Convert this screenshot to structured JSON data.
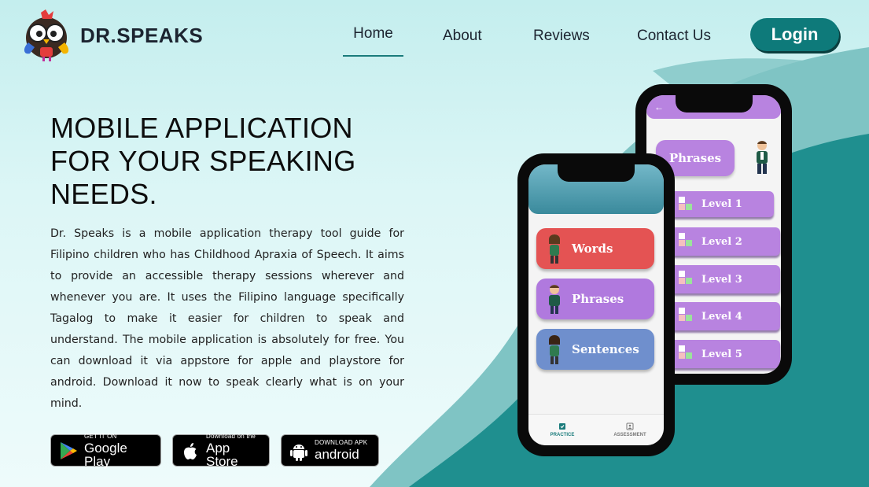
{
  "brand": {
    "name": "DR.SPEAKS"
  },
  "nav": {
    "items": [
      {
        "label": "Home"
      },
      {
        "label": "About"
      },
      {
        "label": "Reviews"
      },
      {
        "label": "Contact Us"
      }
    ],
    "login_label": "Login"
  },
  "hero": {
    "title": "MOBILE APPLICATION FOR YOUR SPEAKING NEEDS.",
    "description": "Dr. Speaks is a mobile application therapy tool guide for Filipino children who has Childhood Apraxia of Speech. It aims to provide an accessible therapy sessions wherever and whenever you are. It uses the Filipino language specifically Tagalog to make it easier for children to speak and understand. The mobile application is absolutely for free. You can download it via appstore for apple and playstore for android. Download it now to speak clearly what is on your mind."
  },
  "badges": {
    "google": {
      "small": "GET IT ON",
      "big": "Google Play"
    },
    "apple": {
      "small": "Download on the",
      "big": "App Store"
    },
    "android": {
      "small": "DOWNLOAD APK",
      "big": "android"
    }
  },
  "phone_back": {
    "title": "Phrases",
    "levels": [
      "Level 1",
      "Level 2",
      "Level 3",
      "Level 4",
      "Level 5"
    ]
  },
  "phone_front": {
    "categories": [
      "Words",
      "Phrases",
      "Sentences"
    ],
    "tabs": [
      "PRACTICE",
      "ASSESSMENT"
    ]
  },
  "colors": {
    "accent": "#0e7a7a",
    "purple": "#b883e0",
    "red": "#e45353",
    "blue": "#6f8fcd"
  }
}
